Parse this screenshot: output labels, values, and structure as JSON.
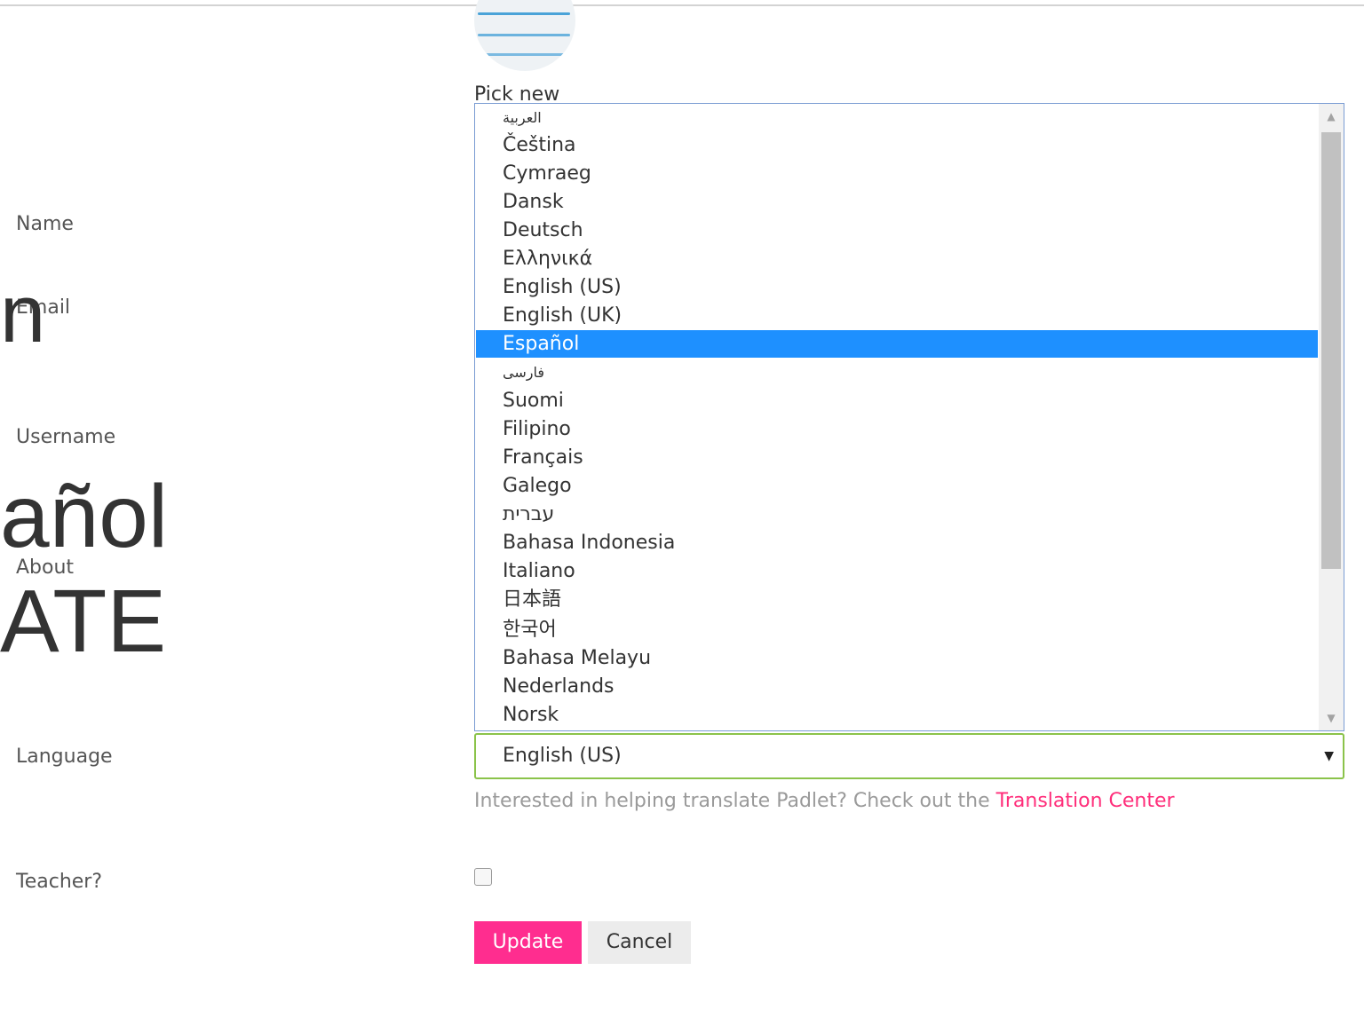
{
  "overlay": {
    "frag1": "n",
    "frag2": "añol",
    "frag3": "ATE"
  },
  "labels": {
    "name": "Name",
    "email": "Email",
    "username": "Username",
    "about": "About",
    "language": "Language",
    "teacher": "Teacher?"
  },
  "avatar": {
    "pick_new": "Pick new"
  },
  "language_dropdown": {
    "options": [
      "العربية",
      "Čeština",
      "Cymraeg",
      "Dansk",
      "Deutsch",
      "Ελληνικά",
      "English (US)",
      "English (UK)",
      "Español",
      "فارسی",
      "Suomi",
      "Filipino",
      "Français",
      "Galego",
      "עברית",
      "Bahasa Indonesia",
      "Italiano",
      "日本語",
      "한국어",
      "Bahasa Melayu",
      "Nederlands",
      "Norsk"
    ],
    "highlighted": "Español",
    "selected_value": "English (US)"
  },
  "hint": {
    "text": "Interested in helping translate Padlet? Check out the ",
    "link": "Translation Center"
  },
  "teacher_checked": false,
  "buttons": {
    "update": "Update",
    "cancel": "Cancel"
  },
  "colors": {
    "accent": "#ff2d8f",
    "link": "#ff2d7a",
    "highlight": "#1e90ff",
    "select_border": "#8bc34a"
  }
}
